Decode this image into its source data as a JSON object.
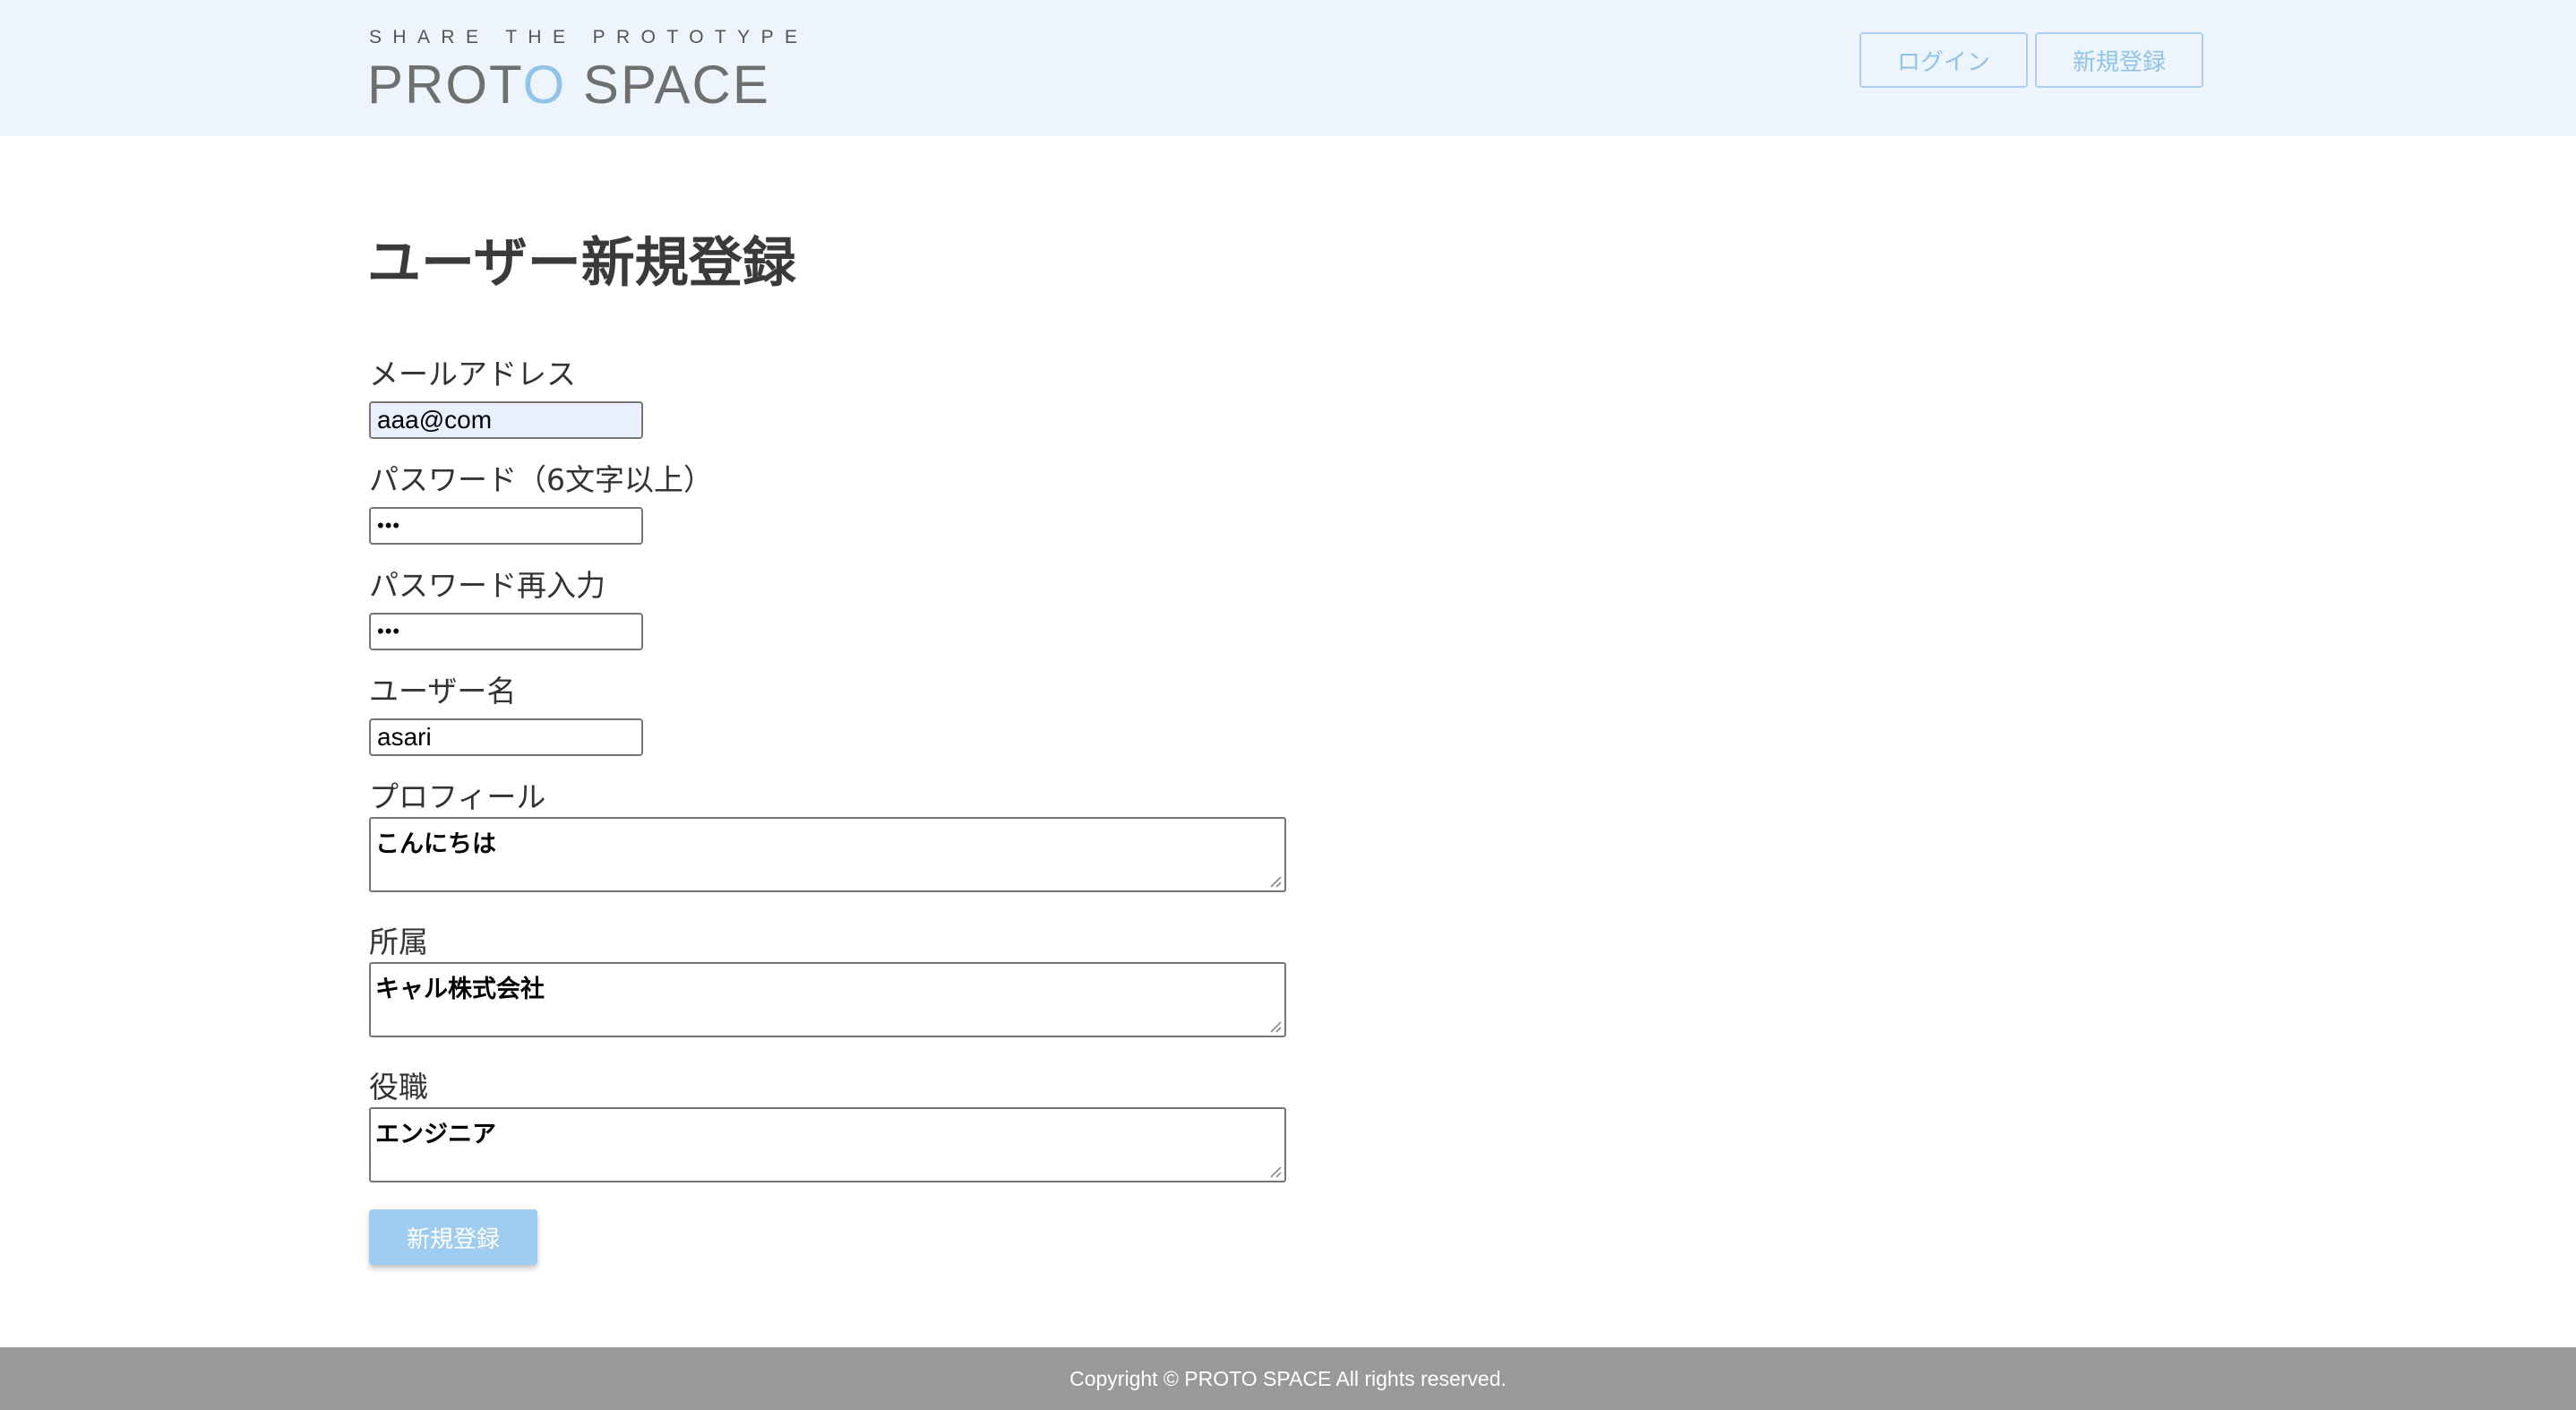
{
  "header": {
    "logo_tagline": "SHARE THE PROTOTYPE",
    "logo_part1": "PROT",
    "logo_accent": "O",
    "logo_part2": " SPACE",
    "login_label": "ログイン",
    "signup_label": "新規登録"
  },
  "page": {
    "title": "ユーザー新規登録"
  },
  "form": {
    "email": {
      "label": "メールアドレス",
      "value": "aaa@com"
    },
    "password": {
      "label": "パスワード（6文字以上）",
      "value": "•••"
    },
    "password_confirm": {
      "label": "パスワード再入力",
      "value": "•••"
    },
    "username": {
      "label": "ユーザー名",
      "value": "asari"
    },
    "profile": {
      "label": "プロフィール",
      "value": "こんにちは"
    },
    "affiliation": {
      "label": "所属",
      "value": "キャル株式会社"
    },
    "position": {
      "label": "役職",
      "value": "エンジニア"
    },
    "submit_label": "新規登録"
  },
  "footer": {
    "copyright": "Copyright © PROTO SPACE All rights reserved."
  },
  "colors": {
    "header_bg": "#eef4fb",
    "accent": "#8fc4ea",
    "submit_bg": "#9fcdf2",
    "footer_bg": "#999999",
    "autofill_bg": "#e8f0fe"
  }
}
